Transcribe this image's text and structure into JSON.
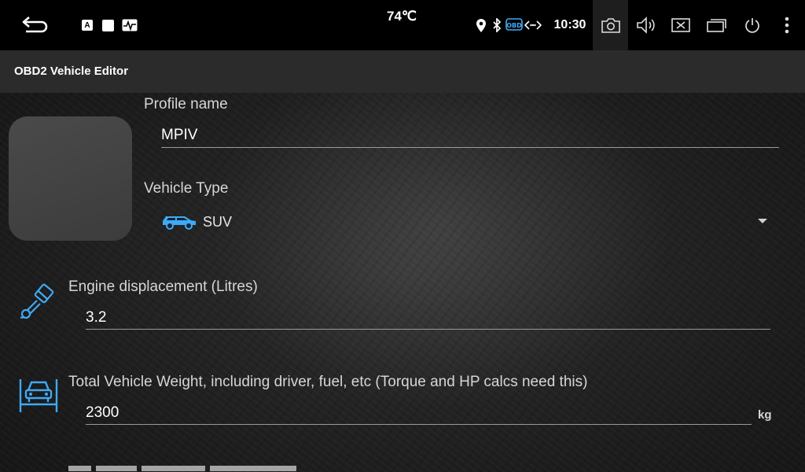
{
  "status_bar": {
    "temperature": "74℃",
    "time": "10:30",
    "icons": [
      "back-icon",
      "a-badge-icon",
      "square-icon",
      "pulse-icon",
      "location-icon",
      "bluetooth-icon",
      "obd-icon",
      "link-icon",
      "camera-icon",
      "volume-icon",
      "close-window-icon",
      "recent-apps-icon",
      "power-icon",
      "more-icon"
    ]
  },
  "app": {
    "title": "OBD2 Vehicle Editor"
  },
  "form": {
    "profile_name": {
      "label": "Profile name",
      "value": "MPIV"
    },
    "vehicle_type": {
      "label": "Vehicle Type",
      "value": "SUV",
      "icon": "suv-icon"
    },
    "engine": {
      "label": "Engine displacement (Litres)",
      "value": "3.2",
      "icon": "piston-icon"
    },
    "weight": {
      "label": "Total Vehicle Weight, including driver, fuel, etc (Torque and HP calcs need this)",
      "value": "2300",
      "unit": "kg",
      "icon": "car-lift-icon"
    }
  },
  "colors": {
    "accent": "#3fa9f5",
    "status_bg": "#000000",
    "appbar_bg": "#2b2b2b"
  }
}
